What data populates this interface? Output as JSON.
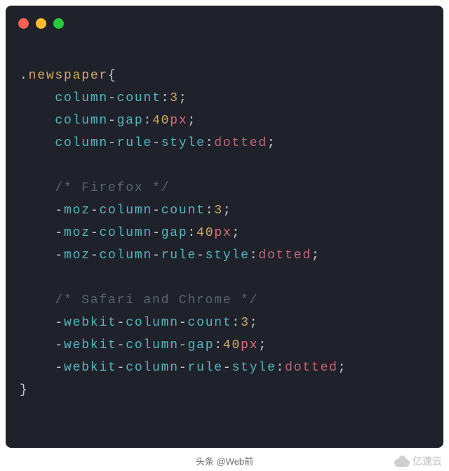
{
  "selector": ".newspaper",
  "blocks": [
    {
      "comment": null,
      "props": [
        {
          "name": "column-count",
          "value": "3",
          "unit": ""
        },
        {
          "name": "column-gap",
          "value": "40",
          "unit": "px"
        },
        {
          "name": "column-rule-style",
          "value": "dotted",
          "unit": ""
        }
      ]
    },
    {
      "comment": "/* Firefox */",
      "prefix": "-moz-",
      "props": [
        {
          "name": "column-count",
          "value": "3",
          "unit": ""
        },
        {
          "name": "column-gap",
          "value": "40",
          "unit": "px"
        },
        {
          "name": "column-rule-style",
          "value": "dotted",
          "unit": ""
        }
      ]
    },
    {
      "comment": "/* Safari and Chrome */",
      "prefix": "-webkit-",
      "props": [
        {
          "name": "column-count",
          "value": "3",
          "unit": ""
        },
        {
          "name": "column-gap",
          "value": "40",
          "unit": "px"
        },
        {
          "name": "column-rule-style",
          "value": "dotted",
          "unit": ""
        }
      ]
    }
  ],
  "footer": {
    "source": "头条 @Web前",
    "brand": "亿速云"
  }
}
